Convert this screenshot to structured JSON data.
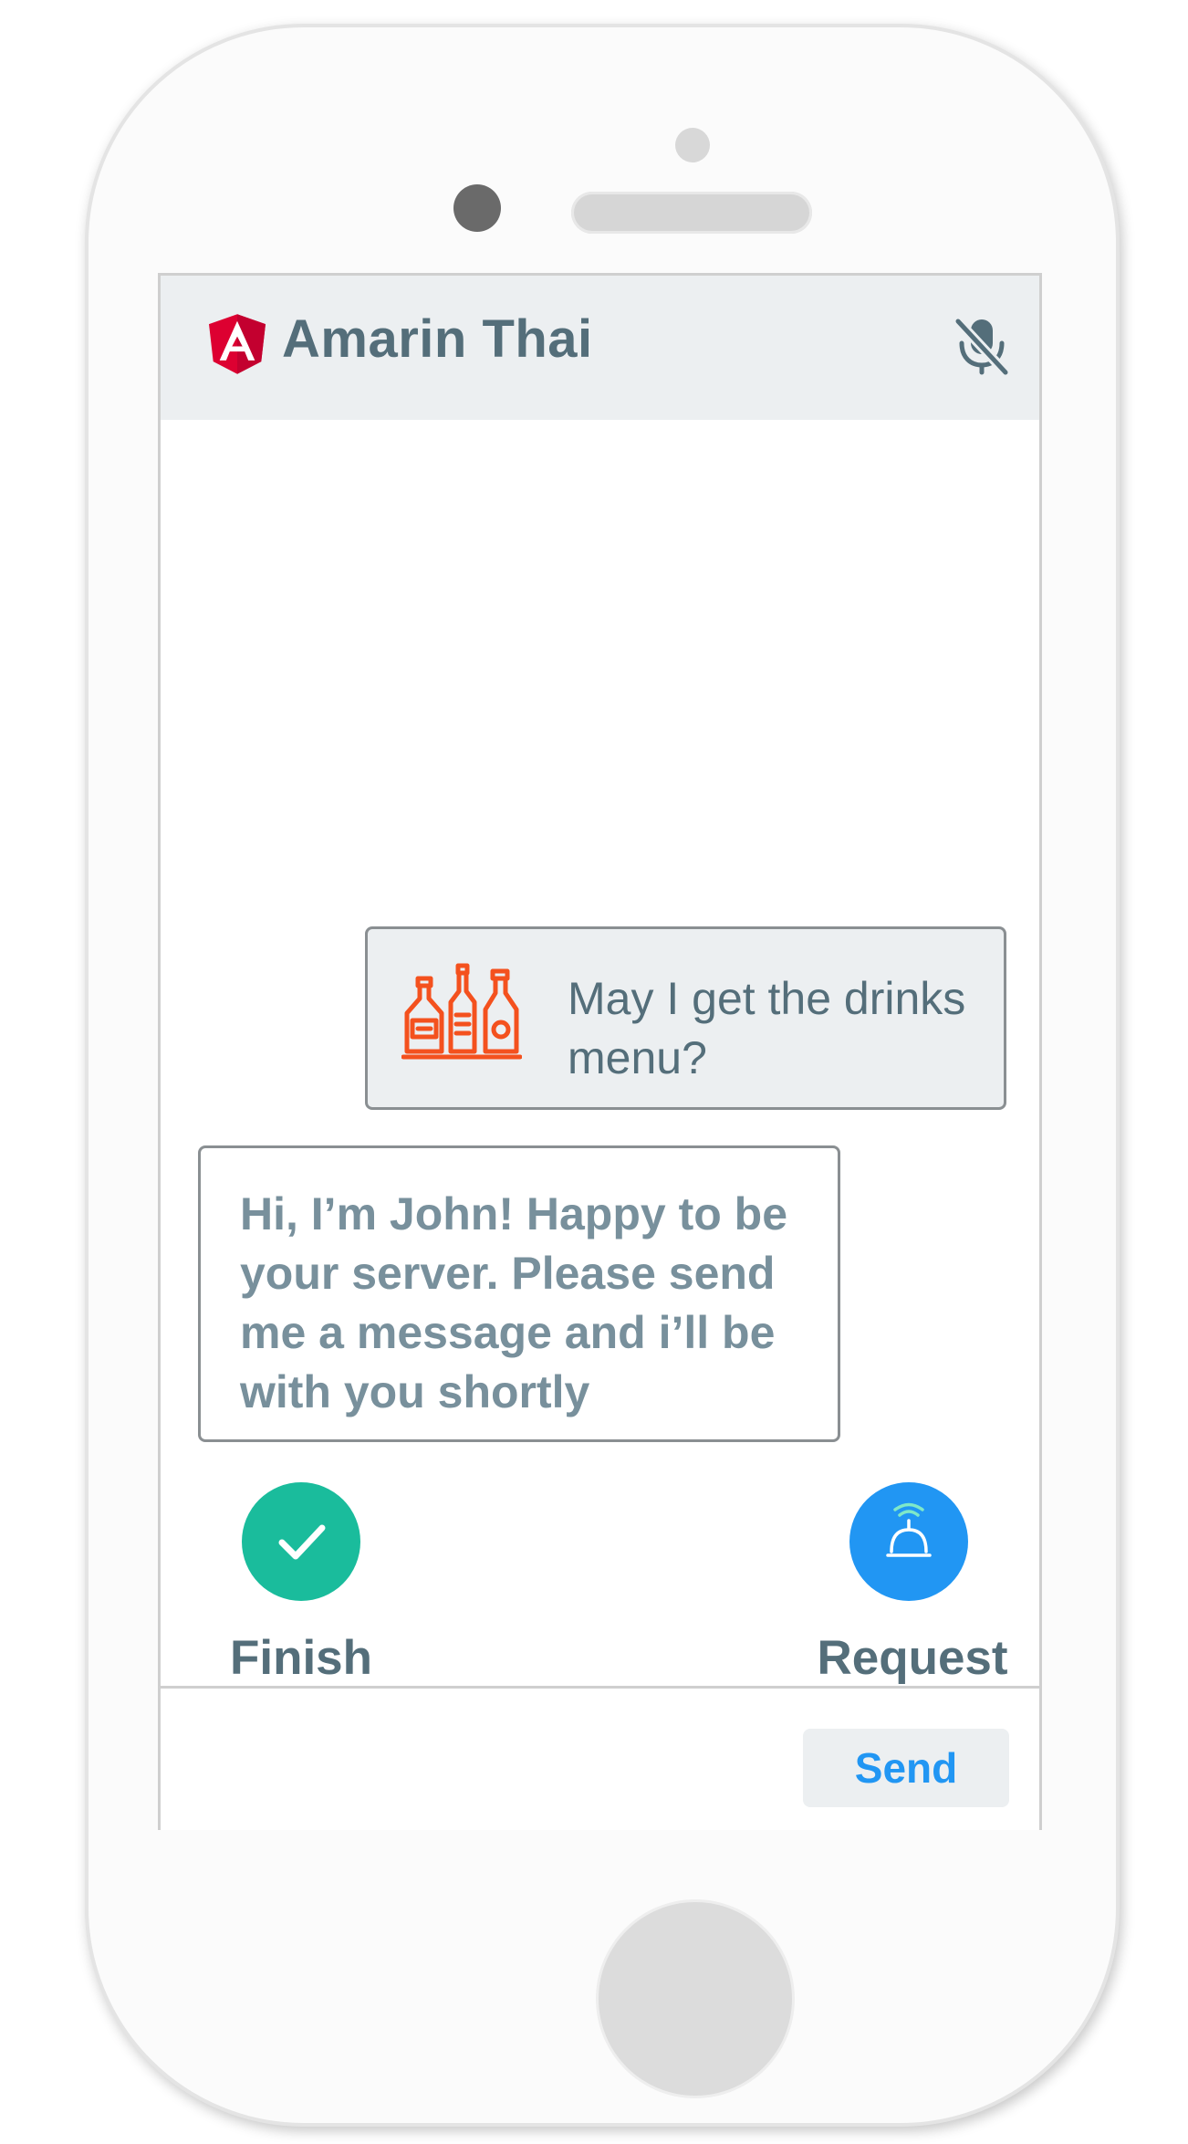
{
  "app": {
    "title": "Amarin Thai",
    "logo_icon": "angular-shield-icon",
    "mute_icon": "microphone-off-icon"
  },
  "messages": [
    {
      "from": "user",
      "icon": "drinks-bottles-icon",
      "text": "May I get the drinks menu?"
    },
    {
      "from": "server",
      "text": "Hi, I’m John! Happy to be your server. Please send me a message and i’ll be with you shortly"
    }
  ],
  "actions": {
    "finish": {
      "label": "Finish",
      "icon": "checkmark-icon",
      "color": "#1abc9c"
    },
    "request": {
      "label": "Request",
      "icon": "service-bell-icon",
      "color": "#2196f3"
    }
  },
  "compose": {
    "input_value": "",
    "placeholder": "",
    "send_label": "Send"
  },
  "colors": {
    "header_bg": "#eceff1",
    "text_primary": "#546e7a",
    "text_secondary": "#78909c",
    "accent_blue": "#2196f3",
    "accent_teal": "#1abc9c",
    "icon_orange": "#f4511e",
    "angular_red": "#dd0031"
  }
}
